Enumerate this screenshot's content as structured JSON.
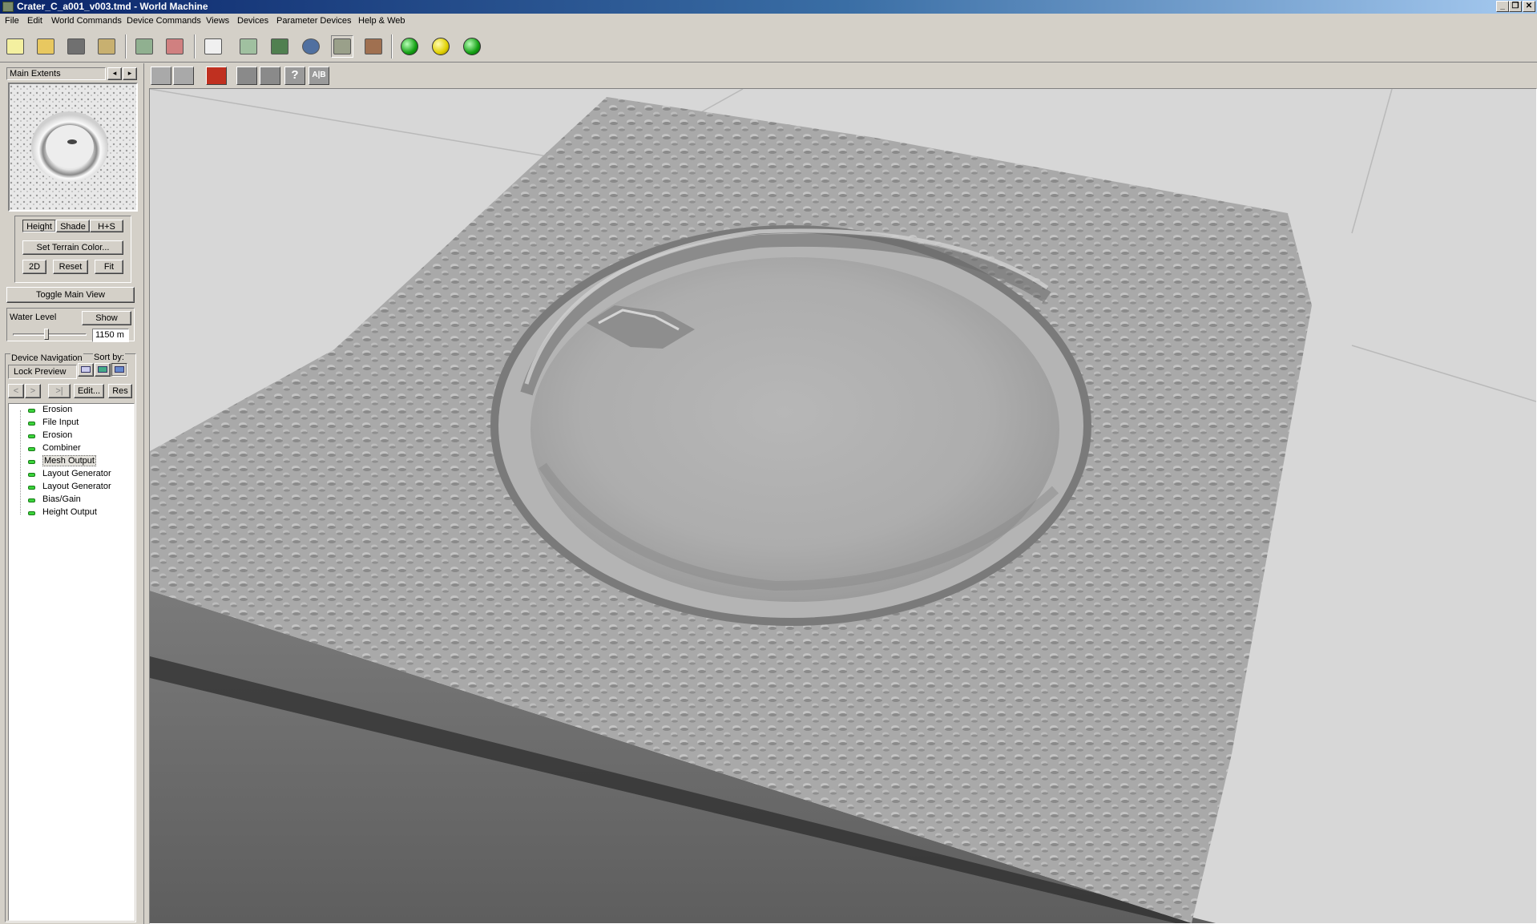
{
  "window": {
    "title": "Crater_C_a001_v003.tmd - World Machine"
  },
  "window_controls": {
    "minimize": "_",
    "restore": "❐",
    "close": "✕"
  },
  "menu": [
    "File",
    "Edit",
    "World Commands",
    "Device Commands",
    "Views",
    "Devices",
    "Parameter Devices",
    "Help & Web"
  ],
  "toolbar": {
    "icons": [
      "new-file-icon",
      "open-folder-icon",
      "save-disk-icon",
      "properties-icon",
      "layout-view-icon",
      "device-view-icon",
      "dice-icon",
      "extents-icon",
      "grid-icon",
      "world-globe-icon",
      "terrain-view-icon",
      "texture-icon"
    ],
    "status_balls": [
      "build-green-icon",
      "build-yellow-icon",
      "explorer-green-icon"
    ]
  },
  "preview": {
    "extents_label": "Main Extents",
    "mode_buttons": [
      "Height",
      "Shade",
      "H+S"
    ],
    "set_color": "Set Terrain Color...",
    "buttons": [
      "2D",
      "Reset",
      "Fit"
    ],
    "toggle_main": "Toggle Main View",
    "water_level_label": "Water Level",
    "water_show": "Show",
    "water_value": "1150 m"
  },
  "navigation": {
    "title": "Device Navigation",
    "sort_label": "Sort by:",
    "lock_preview": "Lock Preview",
    "edit_button": "Edit...",
    "res_button": "Res",
    "arrows": [
      "<",
      ">",
      ">|"
    ],
    "selected_index": 4,
    "devices": [
      "Erosion",
      "File Input",
      "Erosion",
      "Combiner",
      "Mesh Output",
      "Layout Generator",
      "Layout Generator",
      "Bias/Gain",
      "Height Output"
    ]
  },
  "view_toolbar": {
    "icons": [
      "terrain-render-icon",
      "low-res-icon",
      "reset-view-icon",
      "flat-shade-icon",
      "texture-shade-icon",
      "help-icon",
      "alpha-icon"
    ],
    "help_glyph": "?",
    "alpha_glyph": "A|B"
  }
}
